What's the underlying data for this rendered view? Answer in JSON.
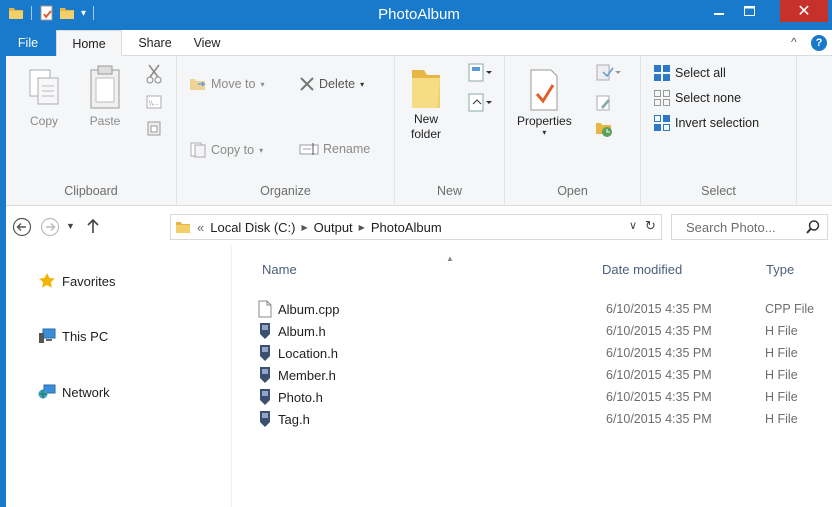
{
  "window": {
    "title": "PhotoAlbum"
  },
  "tabs": {
    "file": "File",
    "home": "Home",
    "share": "Share",
    "view": "View"
  },
  "ribbon": {
    "clipboard": {
      "label": "Clipboard",
      "copy": "Copy",
      "paste": "Paste"
    },
    "organize": {
      "label": "Organize",
      "move_to": "Move to",
      "copy_to": "Copy to",
      "delete": "Delete",
      "rename": "Rename"
    },
    "new": {
      "label": "New",
      "new_folder_line1": "New",
      "new_folder_line2": "folder"
    },
    "open": {
      "label": "Open",
      "properties": "Properties"
    },
    "select": {
      "label": "Select",
      "select_all": "Select all",
      "select_none": "Select none",
      "invert_selection": "Invert selection"
    }
  },
  "address": {
    "overflow": "«",
    "crumbs": [
      "Local Disk (C:)",
      "Output",
      "PhotoAlbum"
    ],
    "search_placeholder": "Search Photo..."
  },
  "nav": {
    "favorites": "Favorites",
    "this_pc": "This PC",
    "network": "Network"
  },
  "columns": {
    "name": "Name",
    "date": "Date modified",
    "type": "Type"
  },
  "files": [
    {
      "name": "Album.cpp",
      "date": "6/10/2015 4:35 PM",
      "type": "CPP File",
      "icon": "document-icon"
    },
    {
      "name": "Album.h",
      "date": "6/10/2015 4:35 PM",
      "type": "H File",
      "icon": "header-file-icon"
    },
    {
      "name": "Location.h",
      "date": "6/10/2015 4:35 PM",
      "type": "H File",
      "icon": "header-file-icon"
    },
    {
      "name": "Member.h",
      "date": "6/10/2015 4:35 PM",
      "type": "H File",
      "icon": "header-file-icon"
    },
    {
      "name": "Photo.h",
      "date": "6/10/2015 4:35 PM",
      "type": "H File",
      "icon": "header-file-icon"
    },
    {
      "name": "Tag.h",
      "date": "6/10/2015 4:35 PM",
      "type": "H File",
      "icon": "header-file-icon"
    }
  ],
  "colors": {
    "accent": "#1979ca",
    "close": "#c7312b",
    "folder": "#e8b645"
  }
}
